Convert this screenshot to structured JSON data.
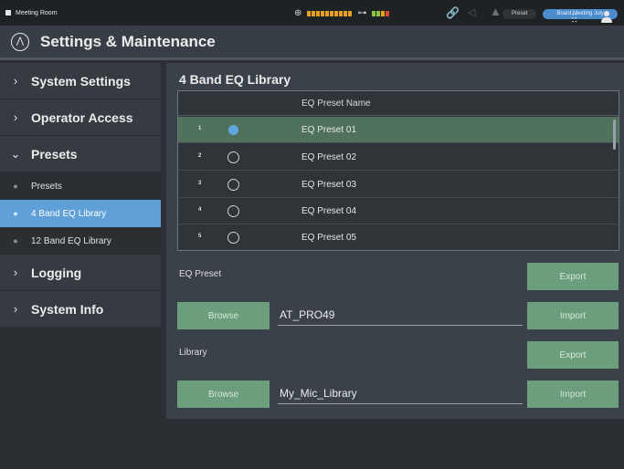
{
  "status": {
    "room_name": "Meeting Room",
    "preset_label": "Preset",
    "meeting_label": "Board Meeting July"
  },
  "header": {
    "title": "Settings & Maintenance"
  },
  "sidebar": {
    "items": [
      {
        "label": "System Settings"
      },
      {
        "label": "Operator Access"
      },
      {
        "label": "Presets"
      }
    ],
    "sub_items": [
      {
        "label": "Presets"
      },
      {
        "label": "4 Band EQ Library"
      },
      {
        "label": "12 Band EQ Library"
      }
    ],
    "bottom_items": [
      {
        "label": "Logging"
      },
      {
        "label": "System Info"
      }
    ]
  },
  "main": {
    "title": "4 Band EQ Library",
    "table": {
      "column_header": "EQ Preset Name",
      "rows": [
        {
          "num": "1",
          "name": "EQ Preset 01",
          "selected": true
        },
        {
          "num": "2",
          "name": "EQ Preset 02",
          "selected": false
        },
        {
          "num": "3",
          "name": "EQ Preset 03",
          "selected": false
        },
        {
          "num": "4",
          "name": "EQ Preset 04",
          "selected": false
        },
        {
          "num": "5",
          "name": "EQ Preset 05",
          "selected": false
        }
      ]
    },
    "eq_preset": {
      "label": "EQ Preset",
      "export_label": "Export",
      "browse_label": "Browse",
      "file_value": "AT_PRO49",
      "import_label": "Import"
    },
    "library": {
      "label": "Library",
      "export_label": "Export",
      "browse_label": "Browse",
      "file_value": "My_Mic_Library",
      "import_label": "Import"
    }
  },
  "colors": {
    "accent_blue": "#5fa0d8",
    "button_green": "#6b9e7c",
    "selected_row": "#50725d"
  }
}
